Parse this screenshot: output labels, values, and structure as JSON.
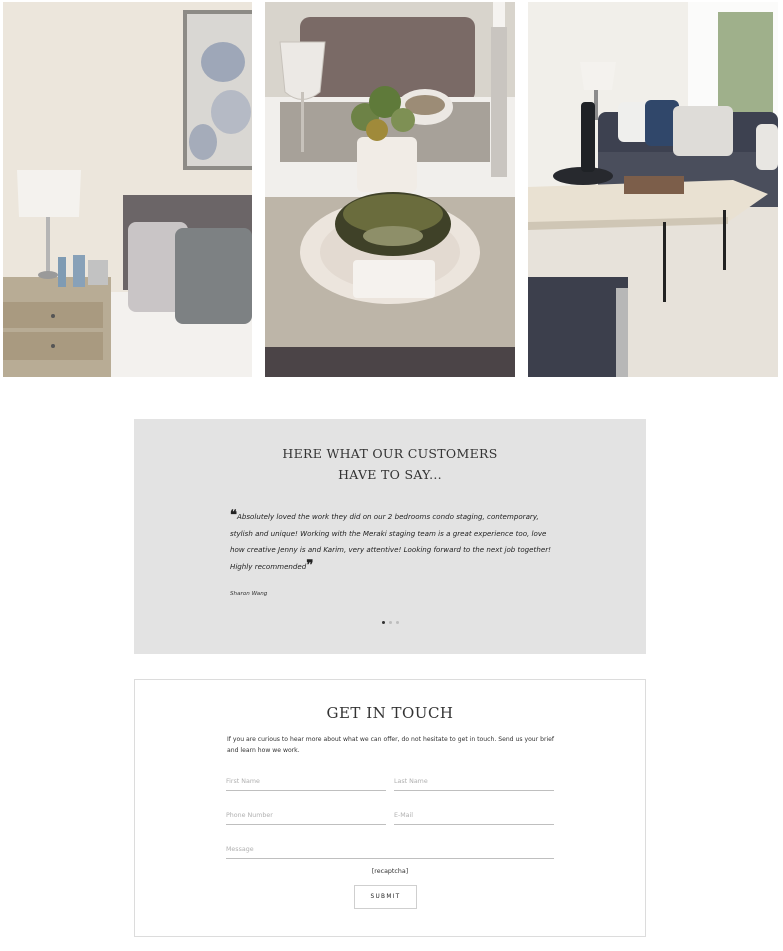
{
  "gallery": {
    "images": [
      {
        "alt": "bedroom-staging-photo"
      },
      {
        "alt": "dining-table-staging-photo"
      },
      {
        "alt": "living-room-staging-photo"
      }
    ]
  },
  "testimonials": {
    "title_line1": "HERE WHAT OUR CUSTOMERS",
    "title_line2": "HAVE TO SAY...",
    "open_quote": "❝",
    "close_quote": "❞",
    "quote": "Absolutely loved the work they did on our 2 bedrooms condo staging, contemporary, stylish and unique! Working with the Meraki staging team is a great experience too, love how creative Jenny is and Karim, very attentive! Looking forward to the next job together! Highly recommended",
    "author": "Sharon Wang",
    "slide_count": 3,
    "active_slide": 1
  },
  "contact": {
    "title": "GET IN TOUCH",
    "intro": "If you are curious to hear more about what we can offer, do not hesitate to get in touch. Send us your brief and learn how we work.",
    "fields": {
      "first_name": "First Name",
      "last_name": "Last Name",
      "phone": "Phone Number",
      "email": "E-Mail",
      "message": "Message"
    },
    "recaptcha": "[recaptcha]",
    "submit": "SUBMIT"
  }
}
